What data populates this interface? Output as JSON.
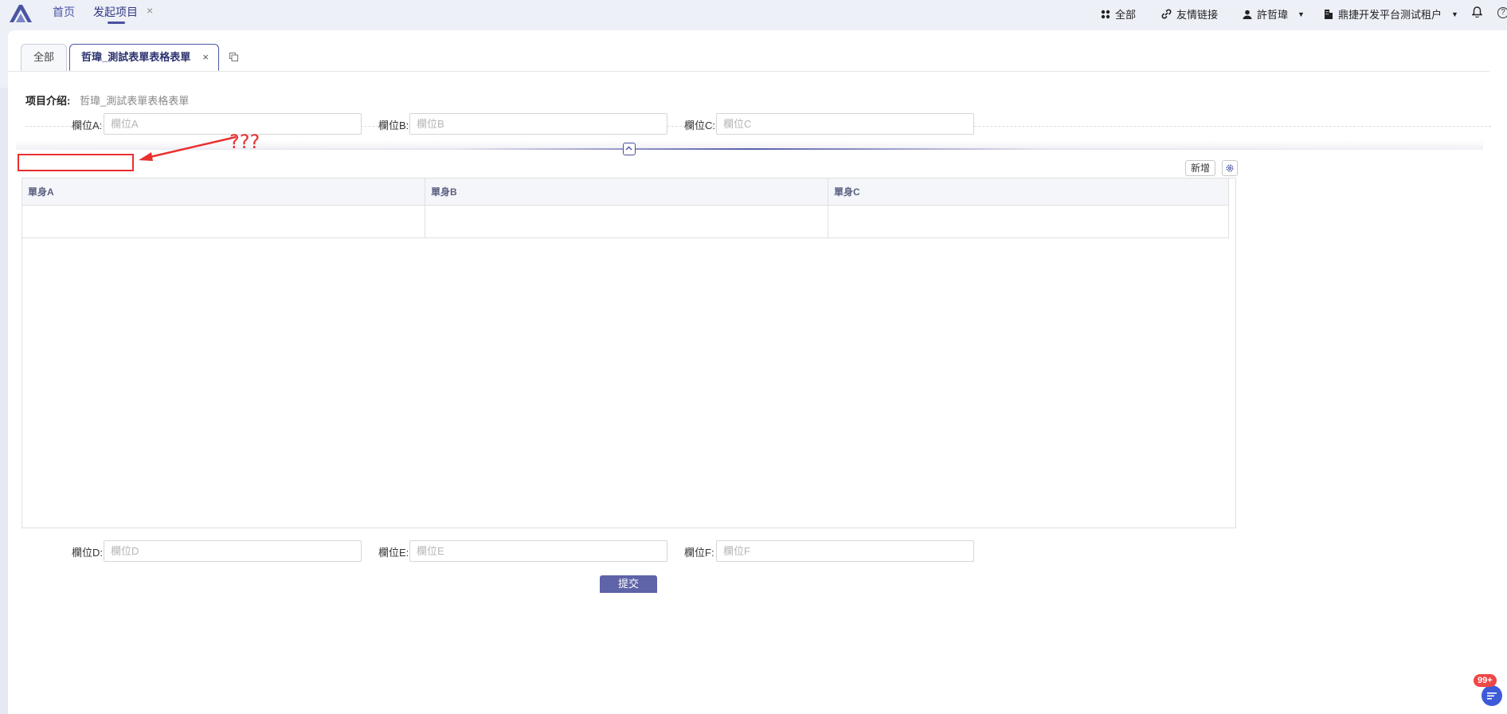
{
  "topbar": {
    "nav": [
      {
        "label": "首页"
      },
      {
        "label": "发起项目"
      }
    ],
    "right": {
      "all_label": "全部",
      "links_label": "友情链接",
      "user_name": "許哲瑋",
      "tenant_name": "鼎捷开发平台测试租户"
    }
  },
  "tabs": {
    "all_label": "全部",
    "active_label": "哲瑋_測試表單表格表單"
  },
  "intro": {
    "label": "项目介绍:",
    "value": "哲瑋_測試表單表格表單"
  },
  "form_top": [
    {
      "label": "欄位A:",
      "placeholder": "欄位A"
    },
    {
      "label": "欄位B:",
      "placeholder": "欄位B"
    },
    {
      "label": "欄位C:",
      "placeholder": "欄位C"
    }
  ],
  "annotation": {
    "text": "???",
    "color": "#e8302e"
  },
  "toolbar": {
    "add_label": "新增"
  },
  "table": {
    "columns": [
      "單身A",
      "單身B",
      "單身C"
    ],
    "rows": [
      [
        "",
        "",
        ""
      ]
    ]
  },
  "form_bottom": [
    {
      "label": "欄位D:",
      "placeholder": "欄位D"
    },
    {
      "label": "欄位E:",
      "placeholder": "欄位E"
    },
    {
      "label": "欄位F:",
      "placeholder": "欄位F"
    }
  ],
  "submit_label": "提交",
  "chat": {
    "badge": "99+"
  },
  "colors": {
    "accent": "#4a4f9e",
    "submit": "#5f63a8",
    "badge": "#ef4747"
  }
}
